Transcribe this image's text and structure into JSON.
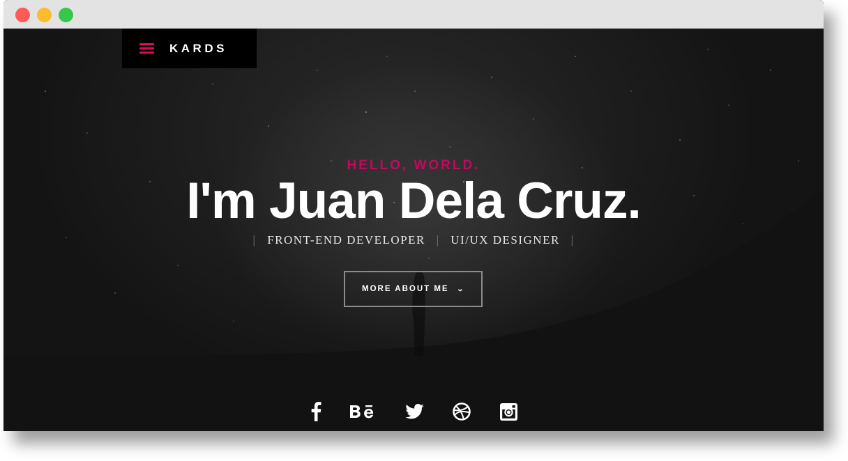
{
  "window": {
    "controls": [
      "close",
      "minimize",
      "maximize"
    ]
  },
  "nav": {
    "brand": "KARDS",
    "menu_icon": "hamburger-menu-icon"
  },
  "hero": {
    "greeting": "HELLO, WORLD.",
    "name": "I'm Juan Dela Cruz.",
    "roles": [
      "FRONT-END DEVELOPER",
      "UI/UX DESIGNER"
    ],
    "role_separator": "|",
    "cta_label": "MORE ABOUT ME",
    "cta_icon": "chevron-down-icon"
  },
  "social": [
    {
      "name": "facebook",
      "icon": "facebook-icon"
    },
    {
      "name": "behance",
      "icon": "behance-icon"
    },
    {
      "name": "twitter",
      "icon": "twitter-icon"
    },
    {
      "name": "dribbble",
      "icon": "dribbble-icon"
    },
    {
      "name": "instagram",
      "icon": "instagram-icon"
    }
  ],
  "colors": {
    "accent": "#e3065f",
    "greeting": "#c4085e",
    "background": "#0e0e0e",
    "text": "#ffffff"
  }
}
